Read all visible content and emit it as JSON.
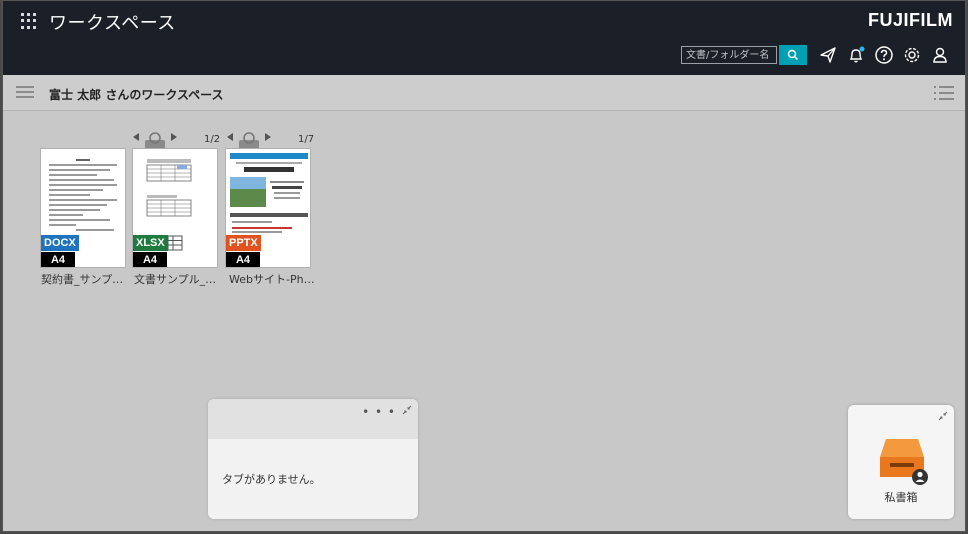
{
  "header": {
    "app_title": "ワークスペース",
    "brand": "FUJIFILM",
    "search_placeholder": "文書/フォルダー名",
    "icons": [
      "send-icon",
      "bell-icon",
      "help-icon",
      "settings-icon",
      "user-icon"
    ],
    "notification_dot_color": "#29b6f6"
  },
  "workspace": {
    "title": "富士 太郎 さんのワークスペース"
  },
  "documents": [
    {
      "name": "契約書_サンプル…",
      "type": "DOCX",
      "size": "A4",
      "badge_color": "#1e73be"
    },
    {
      "name": "文書サンプル_グ…",
      "type": "XLSX",
      "size": "A4",
      "badge_color": "#1f7a3f",
      "page": "1/2"
    },
    {
      "name": "Webサイト-Photo-",
      "type": "PPTX",
      "size": "A4",
      "badge_color": "#e0531f",
      "page": "1/7"
    }
  ],
  "tabpanel": {
    "dots": "• • •",
    "message": "タブがありません。"
  },
  "privbox": {
    "label": "私書箱",
    "box_color": "#e8771e"
  }
}
